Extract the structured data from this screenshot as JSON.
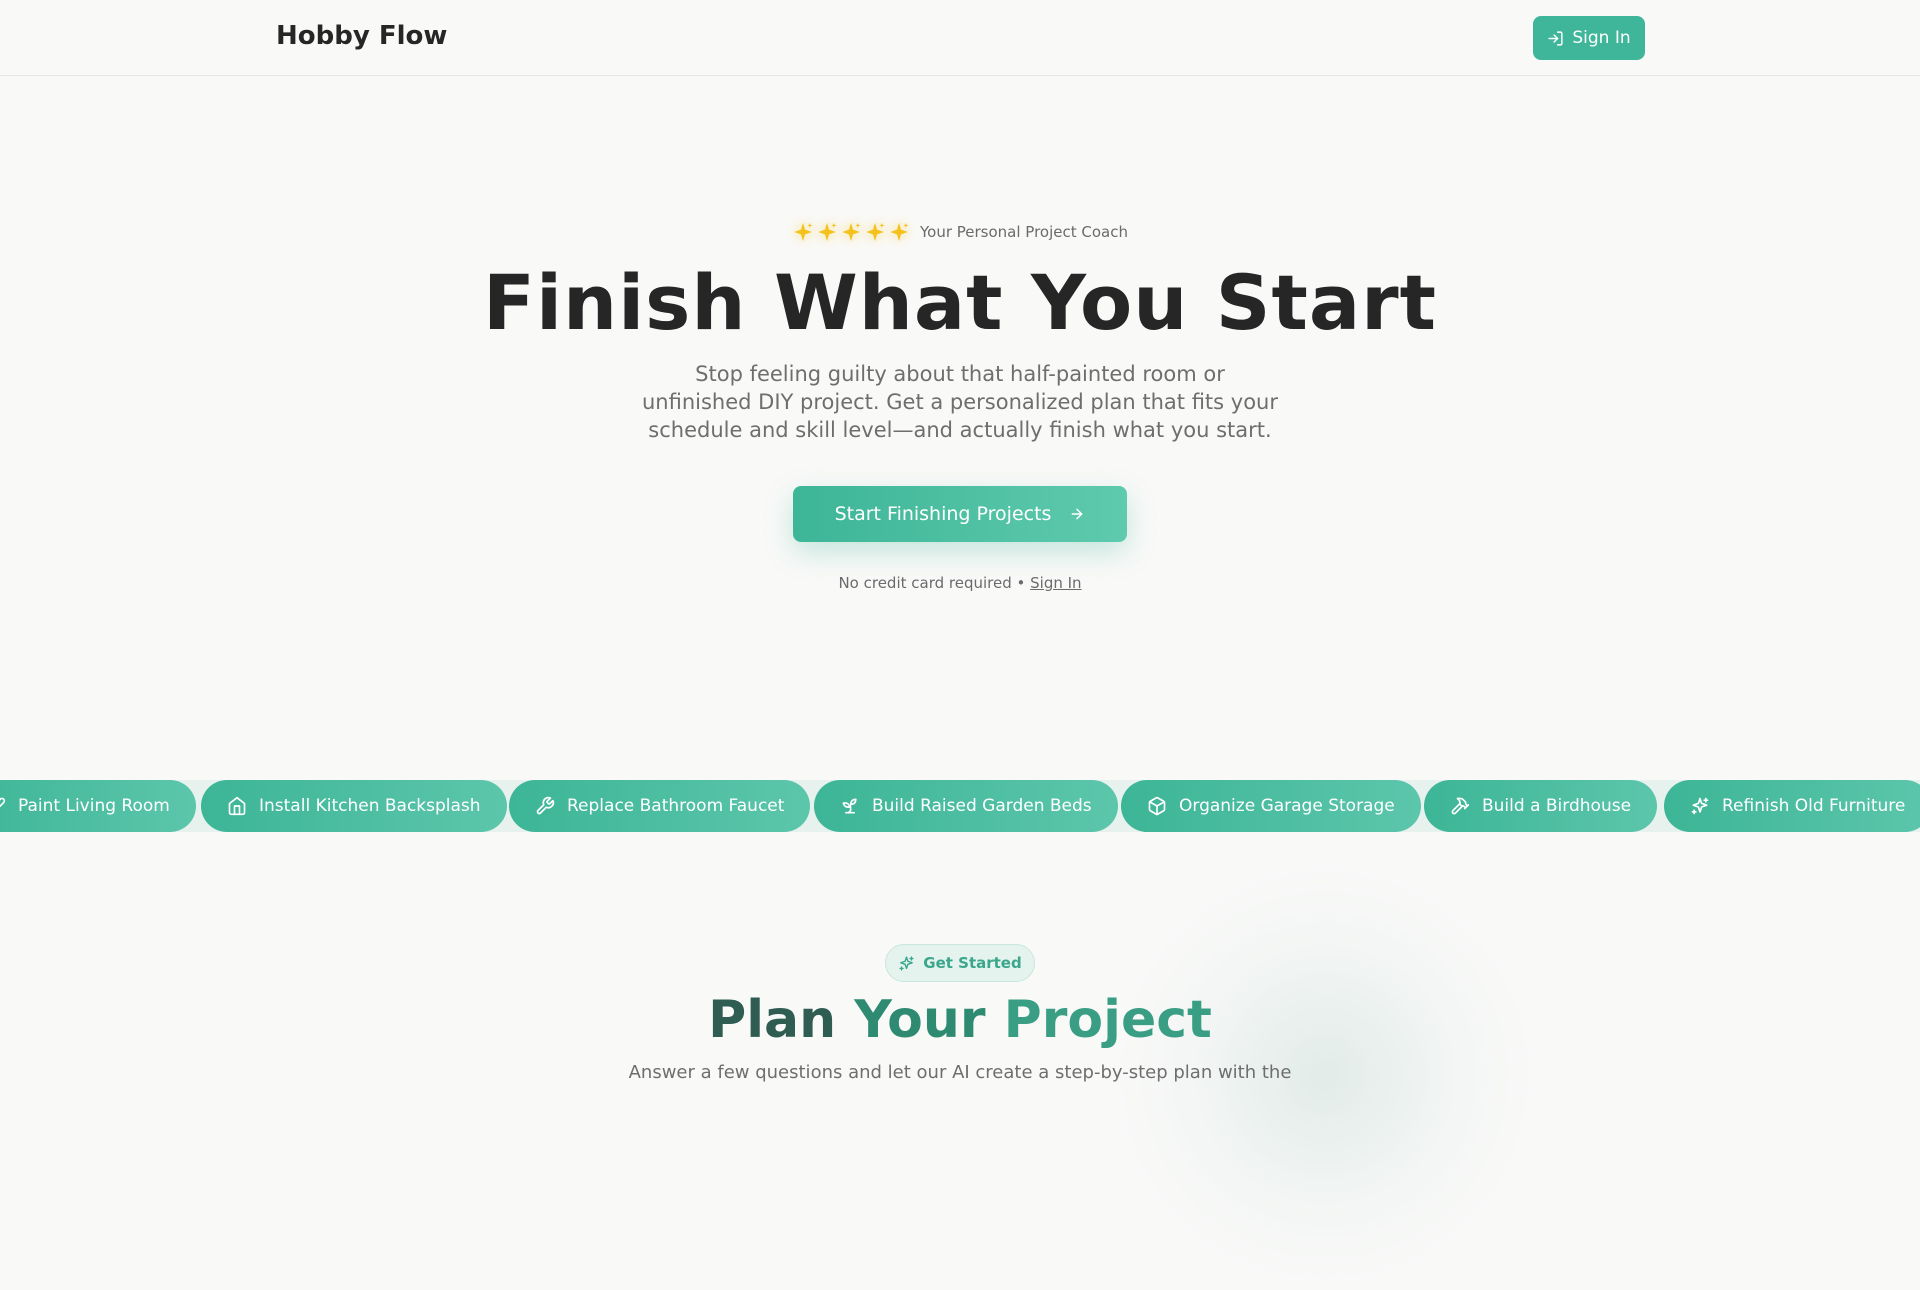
{
  "header": {
    "brand": "Hobby Flow",
    "sign_in_label": "Sign In"
  },
  "hero": {
    "star_count": 5,
    "tagline": "Your Personal Project Coach",
    "title": "Finish What You Start",
    "subtitle": "Stop feeling guilty about that half-painted room or unfinished DIY project. Get a personalized plan that fits your schedule and skill level—and actually finish what you start.",
    "cta_label": "Start Finishing Projects",
    "fine_print": "No credit card required •",
    "fine_print_link": "Sign In"
  },
  "project_chips": [
    {
      "label": "Paint Living Room",
      "icon": "brush-icon"
    },
    {
      "label": "Install Kitchen Backsplash",
      "icon": "home-icon"
    },
    {
      "label": "Replace Bathroom Faucet",
      "icon": "wrench-icon"
    },
    {
      "label": "Build Raised Garden Beds",
      "icon": "sprout-icon"
    },
    {
      "label": "Organize Garage Storage",
      "icon": "box-icon"
    },
    {
      "label": "Build a Birdhouse",
      "icon": "hammer-icon"
    },
    {
      "label": "Refinish Old Furniture",
      "icon": "sparkles-icon"
    }
  ],
  "plan_section": {
    "badge": "Get Started",
    "title_words": [
      "Plan",
      "Your",
      "Project"
    ],
    "subtitle": "Answer a few questions and let our AI create a step-by-step plan with the"
  },
  "colors": {
    "accent": "#3fb69a",
    "star": "#f4c21a",
    "heading_dark": "#262626",
    "plan_title_dark": "#2f5d52"
  }
}
